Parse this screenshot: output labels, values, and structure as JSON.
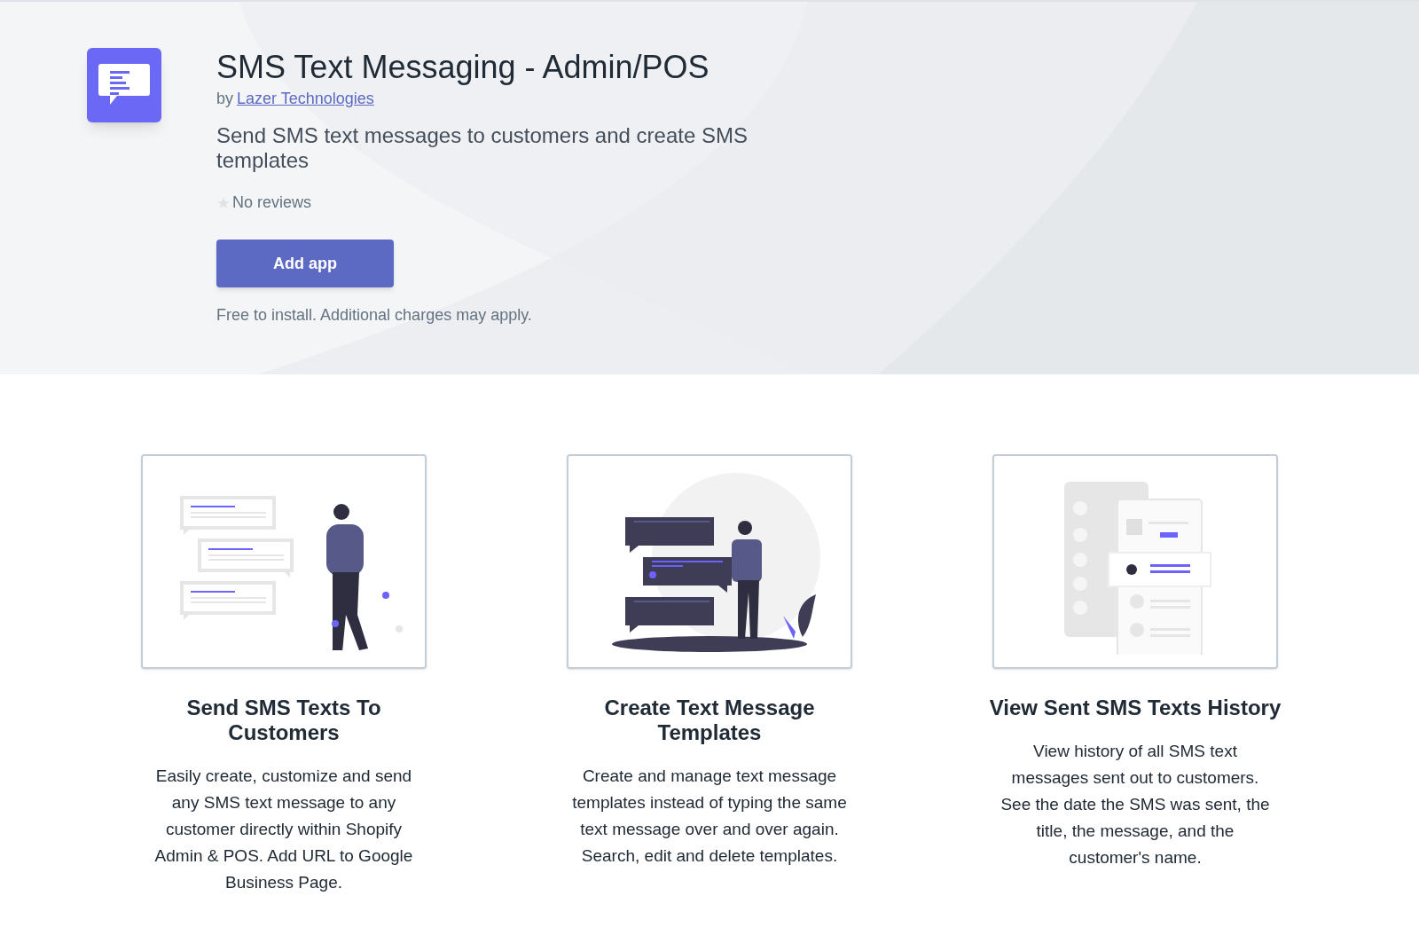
{
  "app": {
    "name": "SMS Text Messaging - Admin/POS",
    "by": "by",
    "developer": "Lazer Technologies",
    "tagline": "Send SMS text messages to customers and create SMS templates",
    "rating": {
      "label": "No reviews"
    },
    "button": "Add app",
    "pricing_note": "Free to install. Additional charges may apply."
  },
  "features": [
    {
      "kind": "chat",
      "title": "Send SMS Texts To Customers",
      "text": "Easily create, customize and send any SMS text message to any customer directly within Shopify Admin & POS. Add URL to Google Business Page."
    },
    {
      "kind": "templates",
      "title": "Create Text Message Templates",
      "text": "Create and manage text message templates instead of typing the same text message over and over again. Search, edit and delete templates."
    },
    {
      "kind": "history",
      "title": "View Sent SMS Texts History",
      "text": "View history of all SMS text messages sent out to customers. See the date the SMS was sent, the title, the message, and the customer's name."
    }
  ]
}
